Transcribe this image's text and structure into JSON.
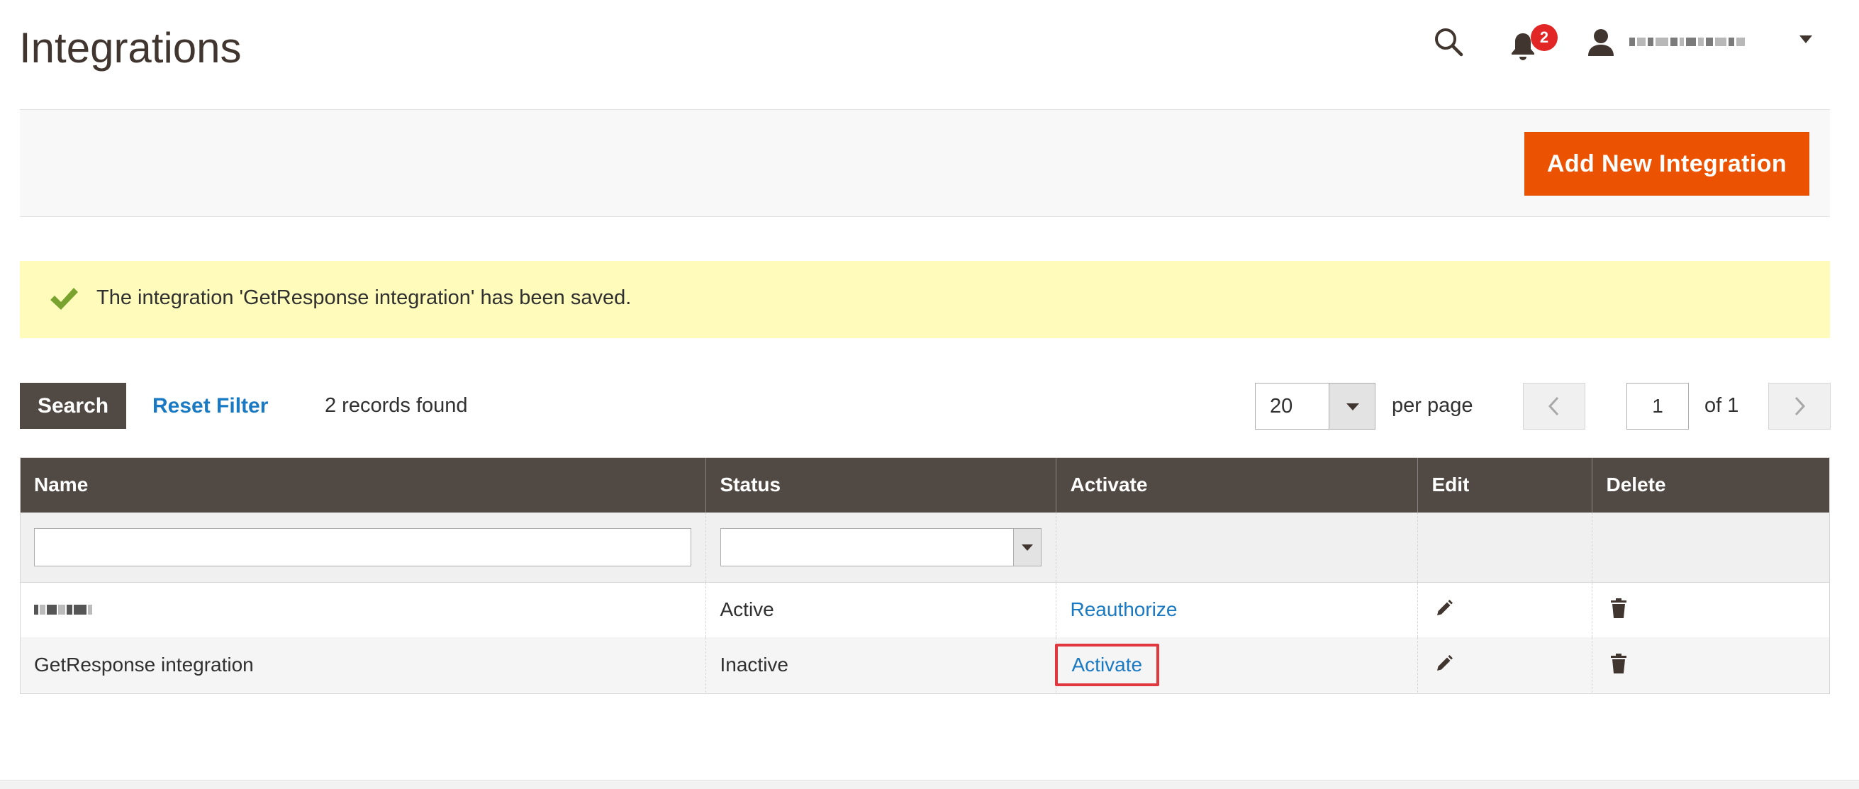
{
  "page": {
    "title": "Integrations"
  },
  "header": {
    "notifications_count": "2"
  },
  "actions": {
    "add_new_label": "Add New Integration"
  },
  "message": {
    "text": "The integration 'GetResponse integration' has been saved.",
    "type": "success"
  },
  "toolbar": {
    "search_label": "Search",
    "reset_label": "Reset Filter",
    "records_found": "2 records found",
    "per_page_value": "20",
    "per_page_label": "per page",
    "current_page": "1",
    "of_pages": "of 1"
  },
  "grid": {
    "columns": [
      "Name",
      "Status",
      "Activate",
      "Edit",
      "Delete"
    ],
    "rows": [
      {
        "name": "",
        "status": "Active",
        "activate": "Reauthorize"
      },
      {
        "name": "GetResponse integration",
        "status": "Inactive",
        "activate": "Activate"
      }
    ]
  },
  "colors": {
    "accent": "#eb5202",
    "header_bg": "#514943",
    "link": "#1979c3",
    "message_bg": "#fffbbb",
    "highlight": "#e0383e"
  }
}
